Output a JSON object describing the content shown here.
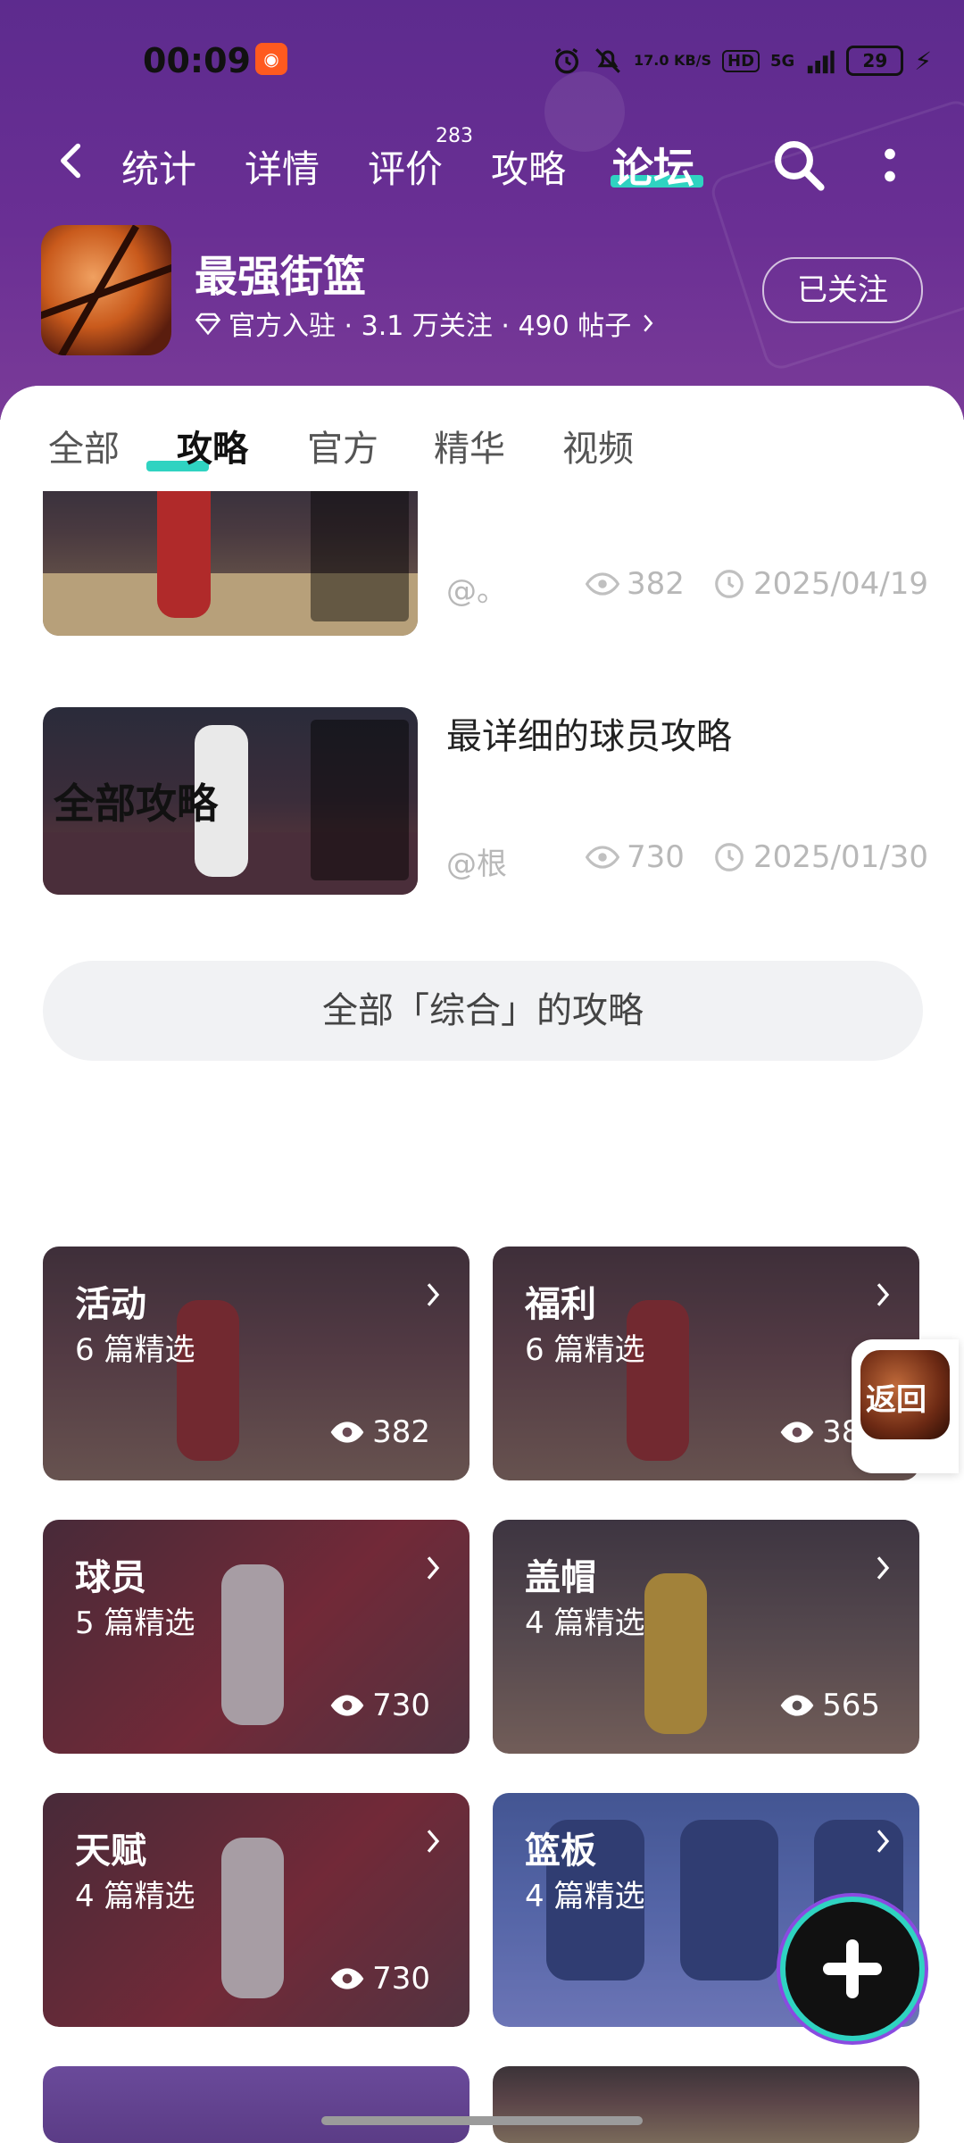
{
  "status_bar": {
    "time": "00:09",
    "network_speed": "17.0 KB/S",
    "hd": "HD",
    "signal": "5G",
    "battery": "29"
  },
  "nav": {
    "tabs": [
      {
        "label": "统计"
      },
      {
        "label": "详情"
      },
      {
        "label": "评价"
      },
      {
        "label": "攻略"
      },
      {
        "label": "论坛"
      }
    ],
    "review_count": "283",
    "active_tab": "论坛"
  },
  "game": {
    "name": "最强街篮",
    "meta": "官方入驻 · 3.1 万关注 · 490 帖子",
    "follow_label": "已关注"
  },
  "sub_tabs": [
    {
      "label": "全部"
    },
    {
      "label": "攻略"
    },
    {
      "label": "官方"
    },
    {
      "label": "精华"
    },
    {
      "label": "视频"
    }
  ],
  "articles": [
    {
      "author": "@。",
      "views": "382",
      "date": "2025/04/19"
    },
    {
      "title": "最详细的球员攻略",
      "author": "@根",
      "views": "730",
      "date": "2025/01/30"
    }
  ],
  "all_button_label": "全部「综合」的攻略",
  "section_title": "全部攻略",
  "categories": [
    {
      "name": "活动",
      "count": "6 篇精选",
      "views": "382"
    },
    {
      "name": "福利",
      "count": "6 篇精选",
      "views": "382"
    },
    {
      "name": "球员",
      "count": "5 篇精选",
      "views": "730"
    },
    {
      "name": "盖帽",
      "count": "4 篇精选",
      "views": "565"
    },
    {
      "name": "天赋",
      "count": "4 篇精选",
      "views": "730"
    },
    {
      "name": "篮板",
      "count": "4 篇精选"
    }
  ],
  "float_back_label": "返回",
  "colors": {
    "accent": "#2fd3c1",
    "header_bg": "#5d2b8e"
  }
}
